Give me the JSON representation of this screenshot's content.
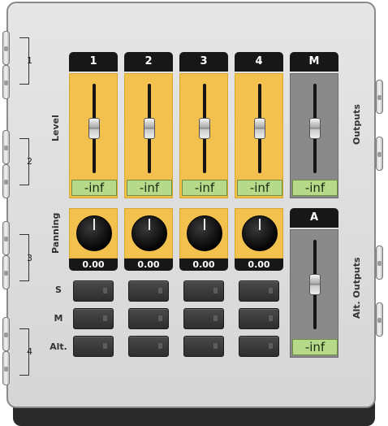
{
  "sections": {
    "level_label": "Level",
    "panning_label": "Panning",
    "outputs_label": "Outputs",
    "alt_outputs_label": "Alt. Outputs"
  },
  "groups": [
    "1",
    "2",
    "3",
    "4"
  ],
  "channels": [
    {
      "name": "1",
      "level_readout": "-inf",
      "pan_value": "0.00",
      "fader_level": 0.5
    },
    {
      "name": "2",
      "level_readout": "-inf",
      "pan_value": "0.00",
      "fader_level": 0.5
    },
    {
      "name": "3",
      "level_readout": "-inf",
      "pan_value": "0.00",
      "fader_level": 0.5
    },
    {
      "name": "4",
      "level_readout": "-inf",
      "pan_value": "0.00",
      "fader_level": 0.5
    }
  ],
  "master": {
    "name": "M",
    "level_readout": "-inf",
    "fader_level": 0.5
  },
  "alt_master": {
    "name": "A",
    "level_readout": "-inf",
    "fader_level": 0.5
  },
  "buttons": {
    "solo_label": "S",
    "mute_label": "M",
    "alt_label": "Alt."
  },
  "colors": {
    "channel_panel": "#f2c14e",
    "master_panel": "#8a8a8a",
    "readout": "#b7d98a",
    "header": "#171717"
  }
}
